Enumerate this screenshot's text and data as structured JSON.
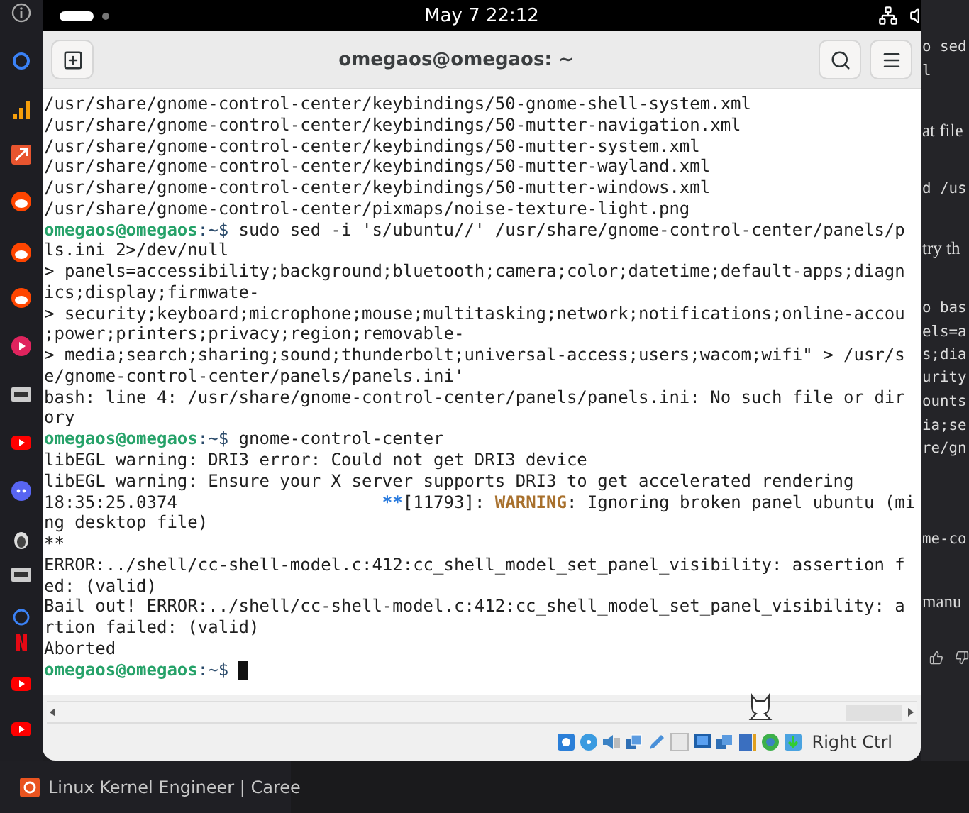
{
  "top_bar": {
    "clock": "May 7  22:12"
  },
  "window": {
    "title": "omegaos@omegaos: ~"
  },
  "terminal": {
    "cursor_visible": true,
    "lines": [
      [
        {
          "kind": "plain",
          "text": "/usr/share/gnome-control-center/keybindings/50-gnome-shell-system.xml"
        }
      ],
      [
        {
          "kind": "plain",
          "text": "/usr/share/gnome-control-center/keybindings/50-mutter-navigation.xml"
        }
      ],
      [
        {
          "kind": "plain",
          "text": "/usr/share/gnome-control-center/keybindings/50-mutter-system.xml"
        }
      ],
      [
        {
          "kind": "plain",
          "text": "/usr/share/gnome-control-center/keybindings/50-mutter-wayland.xml"
        }
      ],
      [
        {
          "kind": "plain",
          "text": "/usr/share/gnome-control-center/keybindings/50-mutter-windows.xml"
        }
      ],
      [
        {
          "kind": "plain",
          "text": "/usr/share/gnome-control-center/pixmaps/noise-texture-light.png"
        }
      ],
      [
        {
          "kind": "prompt",
          "text": "omegaos@omegaos"
        },
        {
          "kind": "path",
          "text": ":~$ "
        },
        {
          "kind": "plain",
          "text": "sudo sed -i 's/ubuntu//' /usr/share/gnome-control-center/panels/p"
        }
      ],
      [
        {
          "kind": "plain",
          "text": "ls.ini 2>/dev/null"
        }
      ],
      [
        {
          "kind": "plain",
          "text": "> panels=accessibility;background;bluetooth;camera;color;datetime;default-apps;diagn"
        }
      ],
      [
        {
          "kind": "plain",
          "text": "ics;display;firmwate-"
        }
      ],
      [
        {
          "kind": "plain",
          "text": "> security;keyboard;microphone;mouse;multitasking;network;notifications;online-accou"
        }
      ],
      [
        {
          "kind": "plain",
          "text": ";power;printers;privacy;region;removable-"
        }
      ],
      [
        {
          "kind": "plain",
          "text": "> media;search;sharing;sound;thunderbolt;universal-access;users;wacom;wifi\" > /usr/s"
        }
      ],
      [
        {
          "kind": "plain",
          "text": "e/gnome-control-center/panels/panels.ini'"
        }
      ],
      [
        {
          "kind": "plain",
          "text": "bash: line 4: /usr/share/gnome-control-center/panels/panels.ini: No such file or dir"
        }
      ],
      [
        {
          "kind": "plain",
          "text": "ory"
        }
      ],
      [
        {
          "kind": "prompt",
          "text": "omegaos@omegaos"
        },
        {
          "kind": "path",
          "text": ":~$ "
        },
        {
          "kind": "plain",
          "text": "gnome-control-center"
        }
      ],
      [
        {
          "kind": "plain",
          "text": "libEGL warning: DRI3 error: Could not get DRI3 device"
        }
      ],
      [
        {
          "kind": "plain",
          "text": "libEGL warning: Ensure your X server supports DRI3 to get accelerated rendering"
        }
      ],
      [
        {
          "kind": "plain",
          "text": "18:35:25.0374                    "
        },
        {
          "kind": "stars",
          "text": "**"
        },
        {
          "kind": "plain",
          "text": "[11793]: "
        },
        {
          "kind": "warning",
          "text": "WARNING"
        },
        {
          "kind": "plain",
          "text": ": Ignoring broken panel ubuntu (mi"
        }
      ],
      [
        {
          "kind": "plain",
          "text": "ng desktop file)"
        }
      ],
      [
        {
          "kind": "plain",
          "text": "**"
        }
      ],
      [
        {
          "kind": "plain",
          "text": "ERROR:../shell/cc-shell-model.c:412:cc_shell_model_set_panel_visibility: assertion f"
        }
      ],
      [
        {
          "kind": "plain",
          "text": "ed: (valid)"
        }
      ],
      [
        {
          "kind": "plain",
          "text": "Bail out! ERROR:../shell/cc-shell-model.c:412:cc_shell_model_set_panel_visibility: a"
        }
      ],
      [
        {
          "kind": "plain",
          "text": "rtion failed: (valid)"
        }
      ],
      [
        {
          "kind": "plain",
          "text": "Aborted"
        }
      ],
      [
        {
          "kind": "prompt",
          "text": "omegaos@omegaos"
        },
        {
          "kind": "path",
          "text": ":~$ "
        }
      ]
    ]
  },
  "status_bar": {
    "host_key": "Right Ctrl"
  },
  "host_page": {
    "fragments": [
      {
        "kind": "code",
        "text": "o sed"
      },
      {
        "kind": "code",
        "text": "l"
      },
      {
        "kind": "prose",
        "text": "at file"
      },
      {
        "kind": "code",
        "text": "d /us"
      },
      {
        "kind": "prose",
        "text": "try th"
      },
      {
        "kind": "code",
        "text": "o bas"
      },
      {
        "kind": "code",
        "text": "els=a"
      },
      {
        "kind": "code",
        "text": "s;dia"
      },
      {
        "kind": "code",
        "text": "urity"
      },
      {
        "kind": "code",
        "text": "ounts"
      },
      {
        "kind": "code",
        "text": "ia;se"
      },
      {
        "kind": "code",
        "text": "re/gn"
      },
      {
        "kind": "code",
        "text": "me-co"
      },
      {
        "kind": "prose",
        "text": "manu"
      }
    ]
  },
  "host_sidebar": {
    "item": "Linux Kernel Engineer | Caree"
  }
}
